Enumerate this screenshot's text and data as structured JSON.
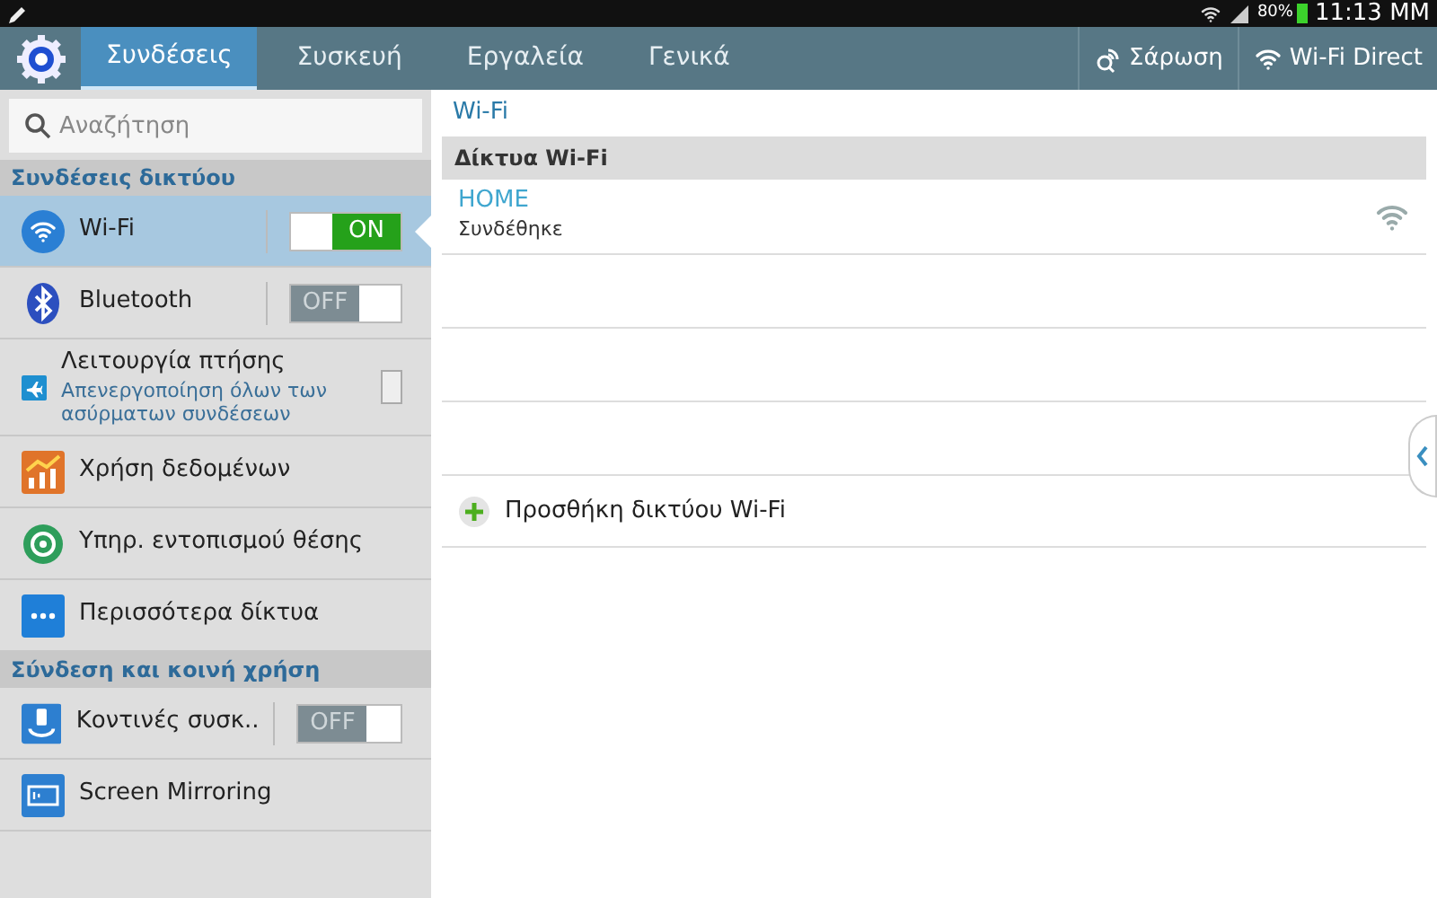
{
  "status_bar": {
    "battery": "80%",
    "time": "11:13 MM"
  },
  "tabs": [
    {
      "label": "Συνδέσεις",
      "selected": true
    },
    {
      "label": "Συσκευή",
      "selected": false
    },
    {
      "label": "Εργαλεία",
      "selected": false
    },
    {
      "label": "Γενικά",
      "selected": false
    }
  ],
  "actions": [
    {
      "label": "Σάρωση"
    },
    {
      "label": "Wi-Fi Direct"
    }
  ],
  "search": {
    "placeholder": "Αναζήτηση"
  },
  "sidebar": {
    "sections": [
      {
        "title": "Συνδέσεις δικτύου",
        "items": [
          {
            "label": "Wi-Fi",
            "kind": "toggle",
            "on": true,
            "toggle_text": "ON",
            "selected": true
          },
          {
            "label": "Bluetooth",
            "kind": "toggle",
            "on": false,
            "toggle_text": "OFF",
            "selected": false
          },
          {
            "label": "Λειτουργία πτήσης",
            "subtitle": "Απενεργοποίηση όλων των ασύρματων συνδέσεων",
            "kind": "checkbox",
            "checked": false,
            "selected": false
          },
          {
            "label": "Χρήση δεδομένων",
            "kind": "plain",
            "selected": false
          },
          {
            "label": "Υπηρ. εντοπισμού θέσης",
            "kind": "plain",
            "selected": false
          },
          {
            "label": "Περισσότερα δίκτυα",
            "kind": "plain",
            "selected": false
          }
        ]
      },
      {
        "title": "Σύνδεση και κοινή χρήση",
        "items": [
          {
            "label": "Κοντινές συσκ..",
            "kind": "toggle",
            "on": false,
            "toggle_text": "OFF",
            "selected": false
          },
          {
            "label": "Screen Mirroring",
            "kind": "plain",
            "selected": false
          }
        ]
      }
    ]
  },
  "content": {
    "title": "Wi-Fi",
    "section": "Δίκτυα Wi-Fi",
    "networks": [
      {
        "name": "HOME",
        "status": "Συνδέθηκε"
      }
    ],
    "add_network": "Προσθήκη δικτύου Wi-Fi"
  }
}
